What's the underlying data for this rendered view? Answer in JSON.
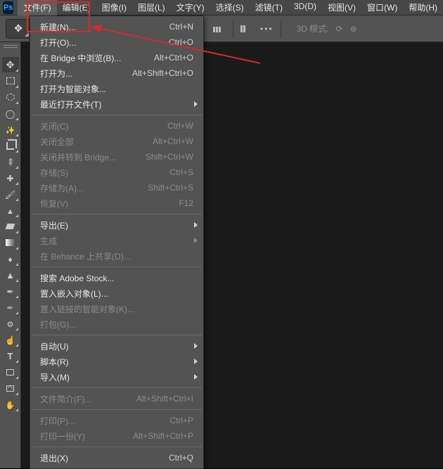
{
  "app": {
    "logo": "Ps"
  },
  "menubar": [
    {
      "label": "文件(F)",
      "active": true
    },
    {
      "label": "编辑(E)"
    },
    {
      "label": "图像(I)"
    },
    {
      "label": "图层(L)"
    },
    {
      "label": "文字(Y)"
    },
    {
      "label": "选择(S)"
    },
    {
      "label": "滤镜(T)"
    },
    {
      "label": "3D(D)"
    },
    {
      "label": "视图(V)"
    },
    {
      "label": "窗口(W)"
    },
    {
      "label": "帮助(H)"
    }
  ],
  "options_bar": {
    "mode3d_label": "3D 模式:",
    "dots": "•••"
  },
  "file_menu": {
    "groups": [
      [
        {
          "label": "新建(N)...",
          "shortcut": "Ctrl+N",
          "enabled": true
        },
        {
          "label": "打开(O)...",
          "shortcut": "Ctrl+O",
          "enabled": true
        },
        {
          "label": "在 Bridge 中浏览(B)...",
          "shortcut": "Alt+Ctrl+O",
          "enabled": true
        },
        {
          "label": "打开为...",
          "shortcut": "Alt+Shift+Ctrl+O",
          "enabled": true
        },
        {
          "label": "打开为智能对象...",
          "shortcut": "",
          "enabled": true
        },
        {
          "label": "最近打开文件(T)",
          "shortcut": "",
          "enabled": true,
          "submenu": true
        }
      ],
      [
        {
          "label": "关闭(C)",
          "shortcut": "Ctrl+W",
          "enabled": false
        },
        {
          "label": "关闭全部",
          "shortcut": "Alt+Ctrl+W",
          "enabled": false
        },
        {
          "label": "关闭并转到 Bridge...",
          "shortcut": "Shift+Ctrl+W",
          "enabled": false
        },
        {
          "label": "存储(S)",
          "shortcut": "Ctrl+S",
          "enabled": false
        },
        {
          "label": "存储为(A)...",
          "shortcut": "Shift+Ctrl+S",
          "enabled": false
        },
        {
          "label": "恢复(V)",
          "shortcut": "F12",
          "enabled": false
        }
      ],
      [
        {
          "label": "导出(E)",
          "shortcut": "",
          "enabled": true,
          "submenu": true
        },
        {
          "label": "生成",
          "shortcut": "",
          "enabled": false,
          "submenu": true
        },
        {
          "label": "在 Behance 上共享(D)...",
          "shortcut": "",
          "enabled": false
        }
      ],
      [
        {
          "label": "搜索 Adobe Stock...",
          "shortcut": "",
          "enabled": true
        },
        {
          "label": "置入嵌入对象(L)...",
          "shortcut": "",
          "enabled": true
        },
        {
          "label": "置入链接的智能对象(K)...",
          "shortcut": "",
          "enabled": false
        },
        {
          "label": "打包(G)...",
          "shortcut": "",
          "enabled": false
        }
      ],
      [
        {
          "label": "自动(U)",
          "shortcut": "",
          "enabled": true,
          "submenu": true
        },
        {
          "label": "脚本(R)",
          "shortcut": "",
          "enabled": true,
          "submenu": true
        },
        {
          "label": "导入(M)",
          "shortcut": "",
          "enabled": true,
          "submenu": true
        }
      ],
      [
        {
          "label": "文件简介(F)...",
          "shortcut": "Alt+Shift+Ctrl+I",
          "enabled": false
        }
      ],
      [
        {
          "label": "打印(P)...",
          "shortcut": "Ctrl+P",
          "enabled": false
        },
        {
          "label": "打印一份(Y)",
          "shortcut": "Alt+Shift+Ctrl+P",
          "enabled": false
        }
      ],
      [
        {
          "label": "退出(X)",
          "shortcut": "Ctrl+Q",
          "enabled": true
        }
      ]
    ]
  },
  "tools": [
    {
      "name": "move-tool",
      "icon": "ic-move",
      "selected": true
    },
    {
      "name": "rect-marquee-tool",
      "icon": "ic-marq"
    },
    {
      "name": "ellipse-marquee-tool",
      "icon": "ic-ellipse"
    },
    {
      "name": "lasso-tool",
      "icon": "ic-lasso"
    },
    {
      "name": "magic-wand-tool",
      "icon": "ic-wand"
    },
    {
      "name": "crop-tool",
      "icon": "ic-crop"
    },
    {
      "name": "eyedropper-tool",
      "icon": "ic-eye"
    },
    {
      "name": "spot-heal-tool",
      "icon": "ic-heal"
    },
    {
      "name": "brush-tool",
      "icon": "ic-brush"
    },
    {
      "name": "clone-stamp-tool",
      "icon": "ic-stamp"
    },
    {
      "name": "eraser-tool",
      "icon": "ic-erase"
    },
    {
      "name": "gradient-tool",
      "icon": "ic-grad"
    },
    {
      "name": "blur-tool",
      "icon": "ic-drop"
    },
    {
      "name": "path-select-tool",
      "icon": "ic-path"
    },
    {
      "name": "pen-tool",
      "icon": "ic-pen"
    },
    {
      "name": "curvature-pen-tool",
      "icon": "ic-curvepen"
    },
    {
      "name": "quick-select-tool",
      "icon": "ic-quick"
    },
    {
      "name": "finger-tool",
      "icon": "ic-finger"
    },
    {
      "name": "type-tool",
      "icon": "ic-type"
    },
    {
      "name": "rectangle-tool",
      "icon": "ic-rect"
    },
    {
      "name": "frame-tool",
      "icon": "ic-frame"
    },
    {
      "name": "hand-tool",
      "icon": "ic-hand"
    }
  ]
}
